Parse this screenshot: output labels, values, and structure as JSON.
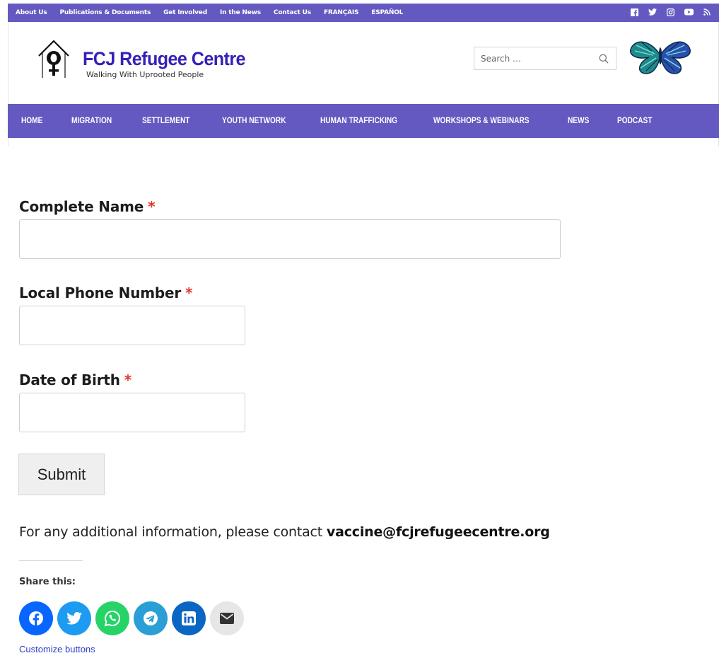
{
  "topbar": {
    "links": [
      "About Us",
      "Publications & Documents",
      "Get Involved",
      "In the News",
      "Contact Us",
      "FRANÇAIS",
      "ESPAÑOL"
    ],
    "social_icons": [
      "facebook-icon",
      "twitter-icon",
      "instagram-icon",
      "youtube-icon",
      "rss-icon"
    ]
  },
  "header": {
    "site_title": "FCJ Refugee Centre",
    "tagline": "Walking With Uprooted People",
    "search_placeholder": "Search …"
  },
  "mainnav": {
    "items": [
      "HOME",
      "MIGRATION",
      "SETTLEMENT",
      "YOUTH NETWORK",
      "HUMAN TRAFFICKING",
      "WORKSHOPS & WEBINARS",
      "NEWS",
      "PODCAST"
    ]
  },
  "form": {
    "fields": [
      {
        "label": "Complete Name",
        "required_mark": "*",
        "value": ""
      },
      {
        "label": "Local Phone Number",
        "required_mark": "*",
        "value": ""
      },
      {
        "label": "Date of Birth",
        "required_mark": "*",
        "value": ""
      }
    ],
    "submit_label": "Submit"
  },
  "contact": {
    "text": "For any additional information, please contact",
    "email": "vaccine@fcjrefugeecentre.org"
  },
  "share": {
    "title": "Share this:",
    "buttons": [
      {
        "icon": "facebook-icon",
        "color": "#0866ff"
      },
      {
        "icon": "twitter-icon",
        "color": "#1d9bf0"
      },
      {
        "icon": "whatsapp-icon",
        "color": "#25d366"
      },
      {
        "icon": "telegram-icon",
        "color": "#2a9fd6"
      },
      {
        "icon": "linkedin-icon",
        "color": "#0a66c2"
      },
      {
        "icon": "email-icon",
        "color": "#e6e6e6"
      }
    ],
    "customize_label": "Customize buttons"
  },
  "colors": {
    "brand_purple": "#6459c0",
    "title_blue": "#3520b8",
    "required_red": "#e3352b"
  }
}
